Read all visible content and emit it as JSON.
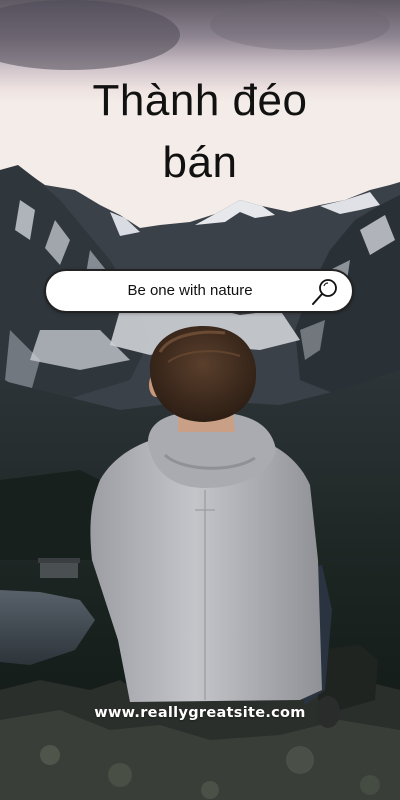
{
  "title": {
    "line1": "Thành đéo",
    "line2": "bán"
  },
  "search": {
    "text": "Be one with nature",
    "icon": "search-icon"
  },
  "footer": {
    "url": "www.reallygreatsite.com"
  },
  "colors": {
    "sky_top": "#5a5560",
    "sky_mid": "#cbbfc7",
    "sky_horizon": "#efe6e4",
    "forest": "#16201c",
    "hoodie": "#b7b8bc",
    "search_bg": "#ffffff",
    "text_dark": "#111111",
    "text_light": "#ffffff"
  }
}
